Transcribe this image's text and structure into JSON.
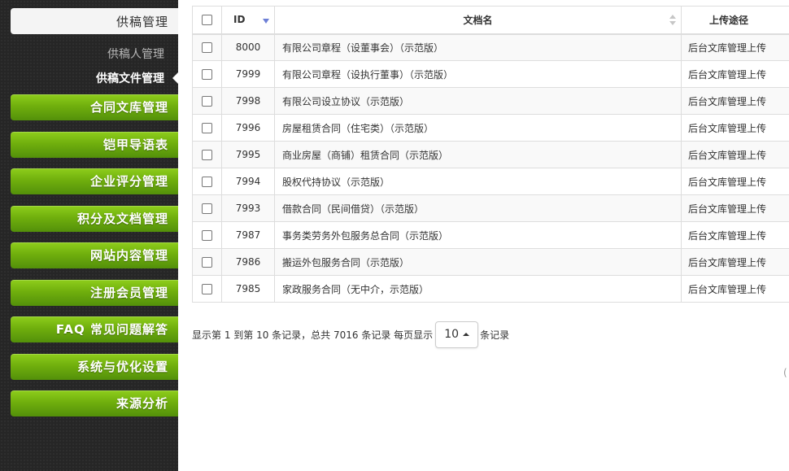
{
  "sidebar": {
    "active_section": "供稿管理",
    "sub_items": [
      {
        "label": "供稿人管理"
      },
      {
        "label": "供稿文件管理"
      }
    ],
    "menu": [
      {
        "label": "合同文库管理"
      },
      {
        "label": "铠甲导语表"
      },
      {
        "label": "企业评分管理"
      },
      {
        "label": "积分及文档管理"
      },
      {
        "label": "网站内容管理"
      },
      {
        "label": "注册会员管理"
      },
      {
        "label": "FAQ 常见问题解答"
      },
      {
        "label": "系统与优化设置"
      },
      {
        "label": "来源分析"
      }
    ]
  },
  "table": {
    "headers": {
      "id": "ID",
      "name": "文档名",
      "source": "上传途径"
    },
    "rows": [
      {
        "id": "8000",
        "name": "有限公司章程（设董事会）（示范版）",
        "source": "后台文库管理上传"
      },
      {
        "id": "7999",
        "name": "有限公司章程（设执行董事）（示范版）",
        "source": "后台文库管理上传"
      },
      {
        "id": "7998",
        "name": "有限公司设立协议（示范版）",
        "source": "后台文库管理上传"
      },
      {
        "id": "7996",
        "name": "房屋租赁合同（住宅类）（示范版）",
        "source": "后台文库管理上传"
      },
      {
        "id": "7995",
        "name": "商业房屋（商铺）租赁合同（示范版）",
        "source": "后台文库管理上传"
      },
      {
        "id": "7994",
        "name": "股权代持协议（示范版）",
        "source": "后台文库管理上传"
      },
      {
        "id": "7993",
        "name": "借款合同（民间借贷）（示范版）",
        "source": "后台文库管理上传"
      },
      {
        "id": "7987",
        "name": "事务类劳务外包服务总合同（示范版）",
        "source": "后台文库管理上传"
      },
      {
        "id": "7986",
        "name": "搬运外包服务合同（示范版）",
        "source": "后台文库管理上传"
      },
      {
        "id": "7985",
        "name": "家政服务合同（无中介，示范版）",
        "source": "后台文库管理上传"
      }
    ]
  },
  "pagination": {
    "summary": "显示第 1 到第 10 条记录，总共 7016 条记录 每页显示",
    "page_size": "10",
    "suffix": "条记录"
  },
  "edge_text": "("
}
